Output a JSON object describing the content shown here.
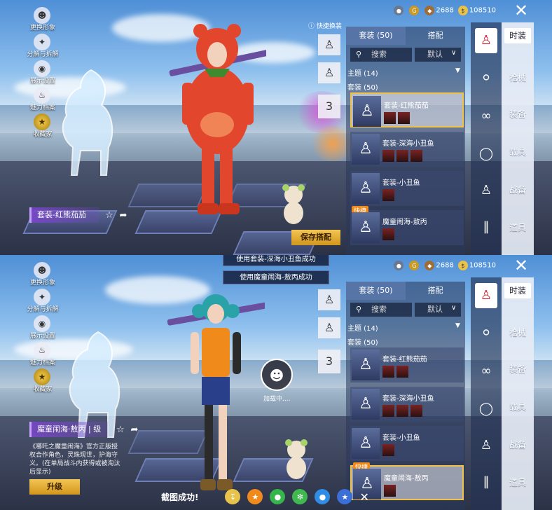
{
  "panels": [
    {
      "id": "p1",
      "left_menu": [
        {
          "icon": "person-icon",
          "label": "更换形象"
        },
        {
          "icon": "puzzle-icon",
          "label": "分解与拆解"
        },
        {
          "icon": "eye-icon",
          "label": "展示设置"
        },
        {
          "icon": "flame-icon",
          "label": "魅力档案"
        },
        {
          "icon": "badge-icon",
          "label": "收藏家"
        }
      ],
      "name_tag": "套装-红熊茄茄",
      "currency": {
        "a": "2688",
        "b": "108510"
      },
      "tabs": [
        "套装 (50)",
        "搭配"
      ],
      "search_placeholder": "搜索",
      "sort_label": "默认",
      "theme_label": "主题 (14)",
      "suit_label": "套装 (50)",
      "quick_label": "快捷换装",
      "rows": [
        {
          "name": "套装-红熊茄茄",
          "selected": true,
          "hot": false
        },
        {
          "name": "套装-深海小丑鱼",
          "selected": false,
          "hot": false
        },
        {
          "name": "套装-小丑鱼",
          "selected": false,
          "hot": false
        },
        {
          "name": "魔童闹海-敖丙",
          "selected": false,
          "hot": true
        }
      ],
      "hot_label": "快捷",
      "save_button": "保存搭配",
      "categories": [
        "时装",
        "枪械",
        "装备",
        "载具",
        "战备",
        "道具"
      ]
    },
    {
      "id": "p2",
      "left_menu": [
        {
          "icon": "person-icon",
          "label": "更换形象"
        },
        {
          "icon": "puzzle-icon",
          "label": "分解与拆解"
        },
        {
          "icon": "eye-icon",
          "label": "展示设置"
        },
        {
          "icon": "flame-icon",
          "label": "魅力档案"
        },
        {
          "icon": "badge-icon",
          "label": "收藏家"
        }
      ],
      "name_tag": "魔童闹海·敖丙 | 级",
      "description": "《哪吒之魔童闹海》官方正版授权合作角色，灵珠现世，护海守义。(在单局战斗内获得或被淘汰后显示)",
      "upgrade_button": "升级",
      "currency": {
        "a": "2688",
        "b": "108510"
      },
      "toasts": [
        "使用套装-深海小丑鱼成功",
        "使用魔童闹海-敖丙成功"
      ],
      "tabs": [
        "套装 (50)",
        "搭配"
      ],
      "search_placeholder": "搜索",
      "sort_label": "默认",
      "theme_label": "主题 (14)",
      "suit_label": "套装 (50)",
      "rows": [
        {
          "name": "套装-红熊茄茄",
          "selected": false,
          "hot": false
        },
        {
          "name": "套装-深海小丑鱼",
          "selected": false,
          "hot": false
        },
        {
          "name": "套装-小丑鱼",
          "selected": false,
          "hot": false
        },
        {
          "name": "魔童闹海-敖丙",
          "selected": true,
          "hot": true
        }
      ],
      "hot_label": "快捷",
      "loading_text": "加载中....",
      "screenshot_text": "截图成功!",
      "categories": [
        "时装",
        "枪械",
        "装备",
        "载具",
        "战备",
        "道具"
      ]
    }
  ],
  "colors": {
    "accent_gold": "#f1c24a",
    "tag_purple": "#7846c8",
    "hot_orange": "#f08a1b"
  }
}
